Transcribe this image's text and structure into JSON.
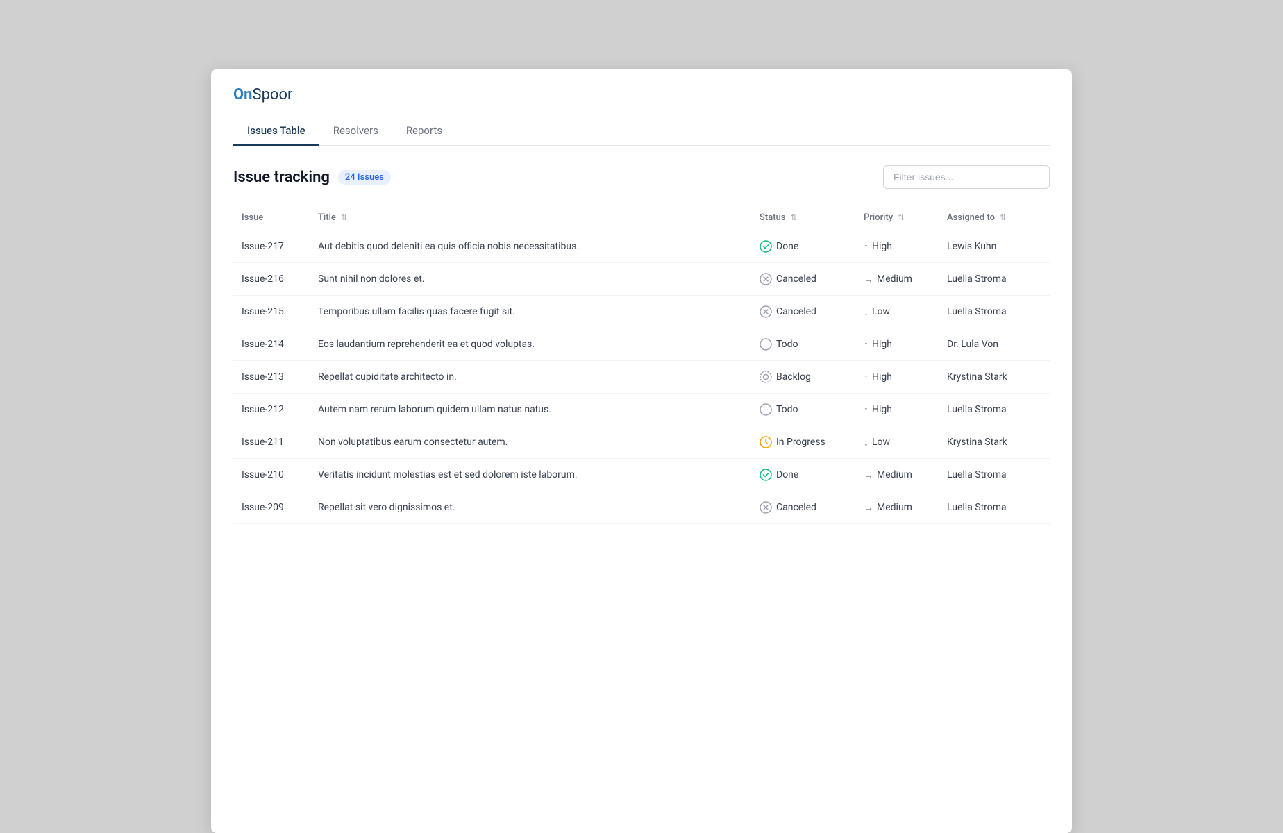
{
  "app": {
    "logo_on": "On",
    "logo_spoor": "Spoor"
  },
  "nav": {
    "tabs": [
      {
        "id": "issues-table",
        "label": "Issues Table",
        "active": true
      },
      {
        "id": "resolvers",
        "label": "Resolvers",
        "active": false
      },
      {
        "id": "reports",
        "label": "Reports",
        "active": false
      }
    ]
  },
  "section": {
    "title": "Issue tracking",
    "badge": "24 Issues",
    "filter_placeholder": "Filter issues..."
  },
  "table": {
    "columns": [
      {
        "id": "issue",
        "label": "Issue",
        "sortable": false
      },
      {
        "id": "title",
        "label": "Title",
        "sortable": true
      },
      {
        "id": "status",
        "label": "Status",
        "sortable": true
      },
      {
        "id": "priority",
        "label": "Priority",
        "sortable": true
      },
      {
        "id": "assigned_to",
        "label": "Assigned to",
        "sortable": true
      }
    ],
    "rows": [
      {
        "id": "Issue-217",
        "title": "Aut debitis quod deleniti ea quis officia nobis necessitatibus.",
        "status": "Done",
        "status_type": "done",
        "priority": "High",
        "priority_type": "up",
        "assigned_to": "Lewis Kuhn"
      },
      {
        "id": "Issue-216",
        "title": "Sunt nihil non dolores et.",
        "status": "Canceled",
        "status_type": "canceled",
        "priority": "Medium",
        "priority_type": "right",
        "assigned_to": "Luella Stroma"
      },
      {
        "id": "Issue-215",
        "title": "Temporibus ullam facilis quas facere fugit sit.",
        "status": "Canceled",
        "status_type": "canceled",
        "priority": "Low",
        "priority_type": "down",
        "assigned_to": "Luella Stroma"
      },
      {
        "id": "Issue-214",
        "title": "Eos laudantium reprehenderit ea et quod voluptas.",
        "status": "Todo",
        "status_type": "todo",
        "priority": "High",
        "priority_type": "up",
        "assigned_to": "Dr. Lula Von"
      },
      {
        "id": "Issue-213",
        "title": "Repellat cupiditate architecto in.",
        "status": "Backlog",
        "status_type": "backlog",
        "priority": "High",
        "priority_type": "up",
        "assigned_to": "Krystina Stark"
      },
      {
        "id": "Issue-212",
        "title": "Autem nam rerum laborum quidem ullam natus natus.",
        "status": "Todo",
        "status_type": "todo",
        "priority": "High",
        "priority_type": "up",
        "assigned_to": "Luella Stroma"
      },
      {
        "id": "Issue-211",
        "title": "Non voluptatibus earum consectetur autem.",
        "status": "In Progress",
        "status_type": "inprogress",
        "priority": "Low",
        "priority_type": "down",
        "assigned_to": "Krystina Stark"
      },
      {
        "id": "Issue-210",
        "title": "Veritatis incidunt molestias est et sed dolorem iste laborum.",
        "status": "Done",
        "status_type": "done",
        "priority": "Medium",
        "priority_type": "right",
        "assigned_to": "Luella Stroma"
      },
      {
        "id": "Issue-209",
        "title": "Repellat sit vero dignissimos et.",
        "status": "Canceled",
        "status_type": "canceled",
        "priority": "Medium",
        "priority_type": "right",
        "assigned_to": "Luella Stroma"
      }
    ]
  }
}
